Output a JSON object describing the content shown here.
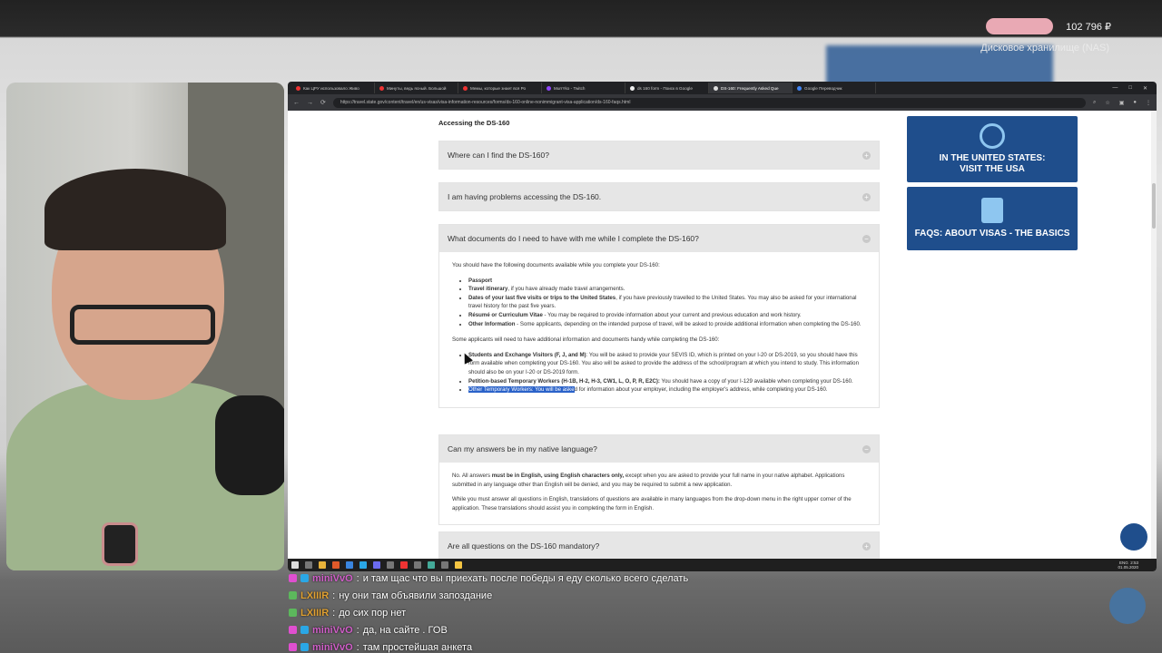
{
  "overlay": {
    "balance": "102 796 ₽",
    "nas_label": "Дисковое хранилище (NAS)"
  },
  "browser": {
    "tabs": [
      {
        "label": "Как ЦРУ использовало Живо"
      },
      {
        "label": "Минуты, ведь ясный. Большой"
      },
      {
        "label": "Мемы, которые знает вся Ро"
      },
      {
        "label": "MurrYkо - Twitch"
      },
      {
        "label": "ds 160 form - Поиск в Google"
      },
      {
        "label": "DS-160: Frequently Asked Que"
      },
      {
        "label": "Google Переводчик"
      }
    ],
    "url": "https://travel.state.gov/content/travel/en/us-visas/visa-information-resources/forms/ds-160-online-nonimmigrant-visa-application/ds-160-faqs.html"
  },
  "page": {
    "section_title": "Accessing the DS-160",
    "accordions": [
      {
        "title": "Where can I find the DS-160?",
        "toggle": "+"
      },
      {
        "title": "I am having problems accessing the DS-160.",
        "toggle": "+"
      },
      {
        "title": "What documents do I need to have with me while I complete the DS-160?",
        "toggle": "−"
      },
      {
        "title": "Can my answers be in my native language?",
        "toggle": "−"
      },
      {
        "title": "Are all questions on the DS-160 mandatory?",
        "toggle": "+"
      }
    ],
    "documents": {
      "intro": "You should have the following documents available while you complete your DS-160:",
      "items": [
        {
          "bold": "Passport",
          "text": ""
        },
        {
          "bold": "Travel itinerary",
          "text": ", if you have already made travel arrangements."
        },
        {
          "bold": "Dates of your last five visits or trips to the United States",
          "text": ", if you have previously travelled to the United States. You may also be asked for your international travel history for the past five years."
        },
        {
          "bold": "Résumé or Curriculum Vitae",
          "text": " - You may be required to provide information about your current and previous education and work history."
        },
        {
          "bold": "Other Information",
          "text": " - Some applicants, depending on the intended purpose of travel, will be asked to provide additional information when completing the DS-160."
        }
      ],
      "intro2": "Some applicants will need to have additional information and documents handy while completing the DS-160:",
      "items2_1_bold": "Students and Exchange Visitors (F, J, and M)",
      "items2_1_text": ": You will be asked to provide your SEVIS ID, which is printed on your I-20 or DS-2019, so you should have this form available when completing your DS-160. You also will be asked to provide the address of the school/program at which you intend to study. This information should also be on your I-20 or DS-2019 form.",
      "items2_2_bold": "Petition-based Temporary Workers (H-1B, H-2, H-3, CW1, L, O, P, R, E2C):",
      "items2_2_text": " You should have a copy of your I-129 available when completing your DS-160.",
      "items2_3_highlight": "Other Temporary Workers: You will be aske",
      "items2_3_text": "d for information about your employer, including the employer's address, while completing your DS-160."
    },
    "language": {
      "p1_start": "No. All answers ",
      "p1_bold": "must be in English, using English characters only,",
      "p1_end": " except when you are asked to provide your full name in your native alphabet. Applications submitted in any language other than English will be denied, and you may be required to submit a new application.",
      "p2": "While you must answer all questions in English, translations of questions are available in many languages from the drop-down menu in the right upper corner of the application. These translations should assist you in completing the form in English."
    },
    "side_cards": [
      {
        "line1": "IN THE UNITED STATES:",
        "line2": "VISIT THE USA"
      },
      {
        "line1": "FAQS: ABOUT VISAS - THE BASICS",
        "line2": ""
      }
    ]
  },
  "taskbar": {
    "lang": "ENG",
    "time": "2:53",
    "date": "01.05.2020"
  },
  "chat": [
    {
      "nick": "miniVvO",
      "sep": ": ",
      "text": "и там щас что вы приехать после победы я еду сколько всего сделать"
    },
    {
      "nick": "LXIIIR",
      "sep": ": ",
      "text": "ну они там объявили запоздание"
    },
    {
      "nick": "LXIIIR",
      "sep": ": ",
      "text": "до сих пор нет"
    },
    {
      "nick": "miniVvO",
      "sep": ": ",
      "text": "да, на сайте . ГОВ"
    },
    {
      "nick": "miniVvO",
      "sep": ": ",
      "text": "там простейшая анкета"
    }
  ]
}
